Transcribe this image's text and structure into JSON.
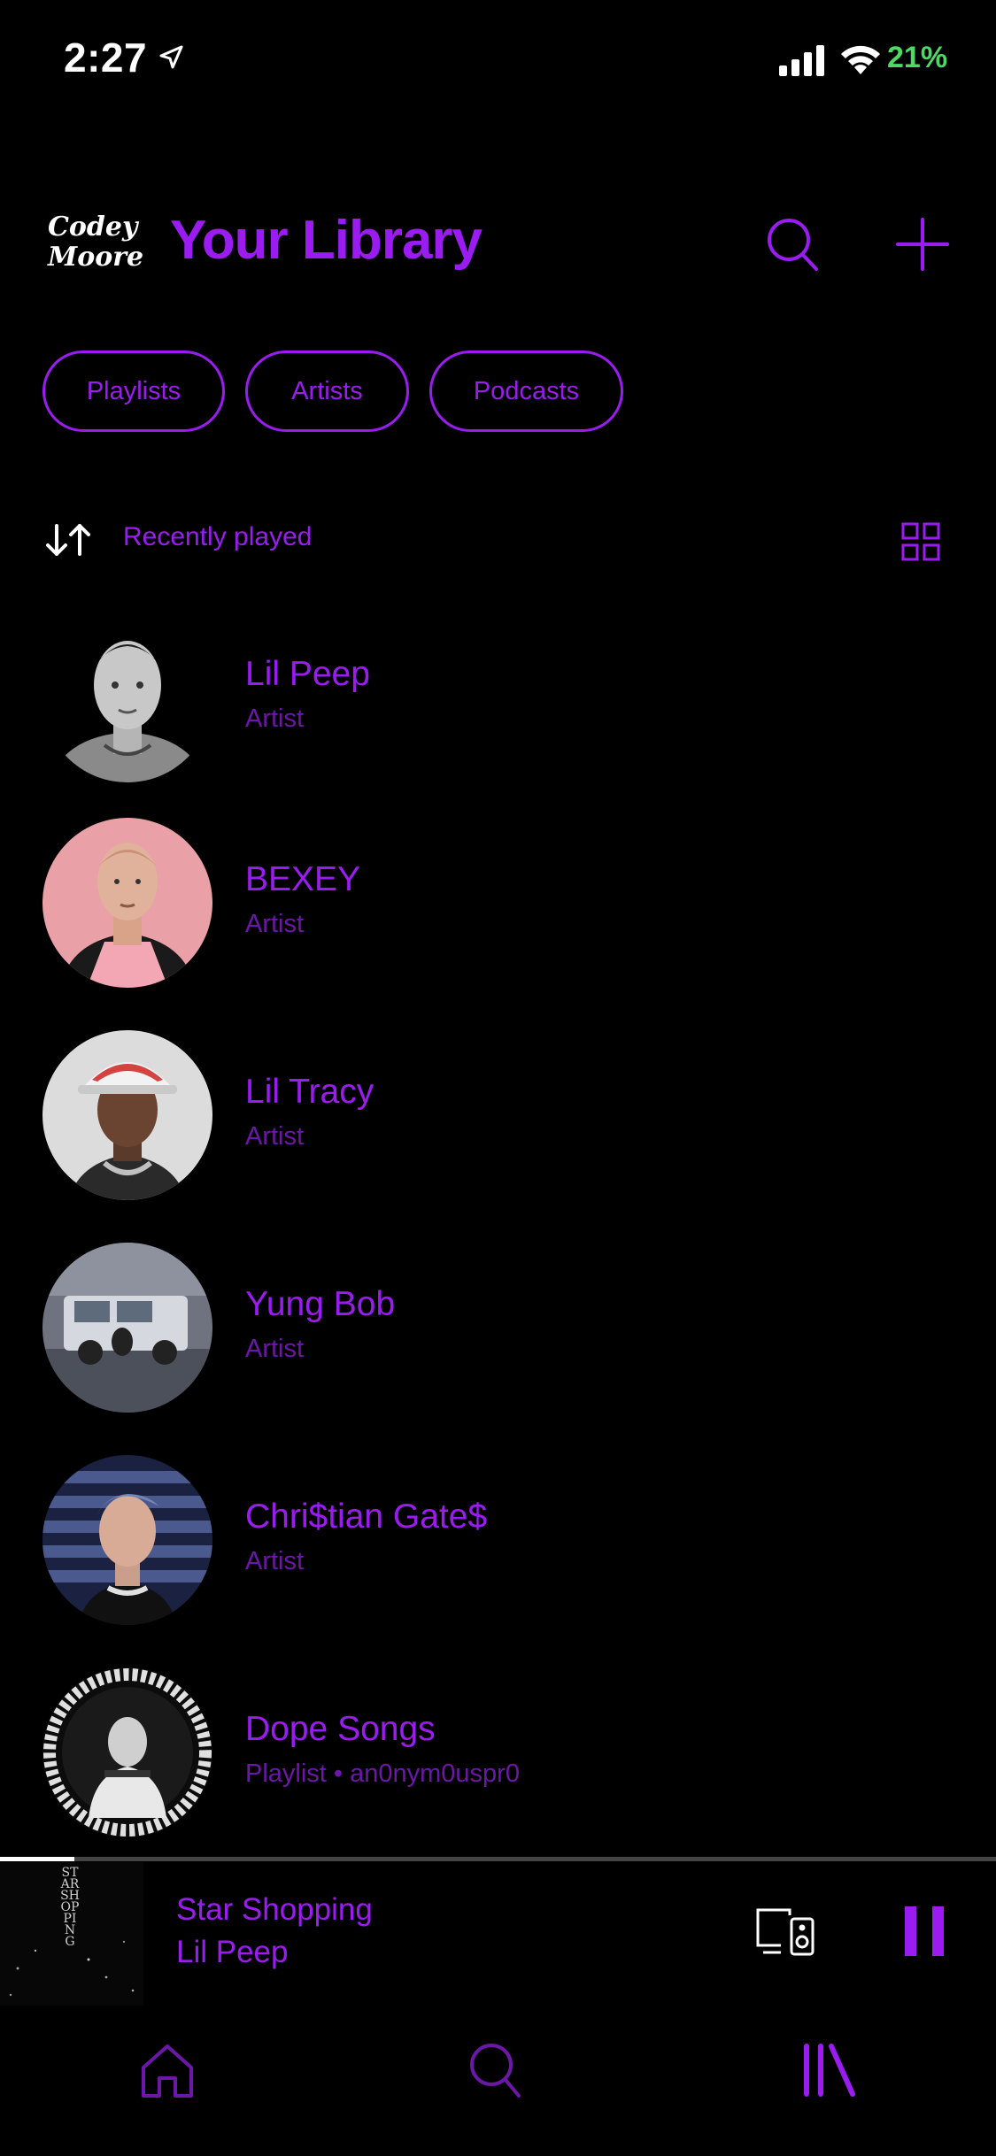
{
  "status_bar": {
    "time": "2:27",
    "battery": "21%",
    "icons": [
      "location-arrow-icon",
      "cellular-signal-icon",
      "wifi-icon"
    ]
  },
  "header": {
    "logo_text_line1": "Codey",
    "logo_text_line2": "Moore",
    "title": "Your Library",
    "icons": [
      "search-icon",
      "plus-icon"
    ]
  },
  "filters": [
    "Playlists",
    "Artists",
    "Podcasts"
  ],
  "sort": {
    "label": "Recently played",
    "icons": [
      "sort-icon",
      "grid-view-icon"
    ]
  },
  "items": [
    {
      "title": "Lil Peep",
      "subtitle": "Artist"
    },
    {
      "title": "BEXEY",
      "subtitle": "Artist"
    },
    {
      "title": "Lil Tracy",
      "subtitle": "Artist"
    },
    {
      "title": "Yung Bob",
      "subtitle": "Artist"
    },
    {
      "title": "Chri$tian Gate$",
      "subtitle": "Artist"
    },
    {
      "title": "Dope Songs",
      "subtitle": "Playlist • an0nym0uspr0"
    }
  ],
  "now_playing": {
    "title": "Star Shopping",
    "artist": "Lil Peep",
    "art_text": "STAR SHOPPING",
    "progress": 0.075,
    "icons": [
      "devices-icon",
      "pause-icon"
    ]
  },
  "bottom_nav": {
    "icons": [
      "home-icon",
      "search-icon",
      "library-icon"
    ]
  },
  "colors": {
    "accent": "#9b1cf0",
    "accent_dim": "#6c17a8",
    "background": "#000000",
    "battery": "#4cd964"
  }
}
